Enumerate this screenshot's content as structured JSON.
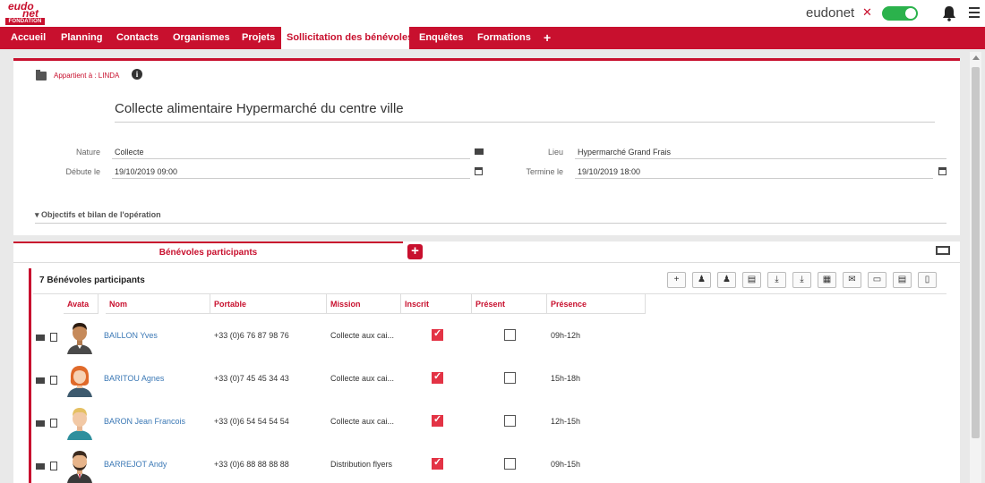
{
  "app": {
    "logo_top": "eudo",
    "logo_mid": "net",
    "logo_sub": "FONDATION",
    "brand": "eudonet",
    "brand_mark": "✕"
  },
  "nav": {
    "items": [
      "Accueil",
      "Planning",
      "Contacts",
      "Organismes",
      "Projets",
      "Sollicitation des bénévoles",
      "Enquêtes",
      "Formations",
      "+"
    ],
    "active_index": 5
  },
  "record": {
    "owner": "Appartient à : LINDA",
    "title": "Collecte alimentaire Hypermarché du centre ville",
    "fields": {
      "nature_label": "Nature",
      "nature_value": "Collecte",
      "debut_label": "Débute le",
      "debut_value": "19/10/2019 09:00",
      "lieu_label": "Lieu",
      "lieu_value": "Hypermarché Grand Frais",
      "termine_label": "Termine le",
      "termine_value": "19/10/2019 18:00"
    },
    "objectifs": "▾  Objectifs et bilan de l'opération"
  },
  "tabs": {
    "active_label": "Bénévoles participants",
    "add_label": "+"
  },
  "participants": {
    "count_label": "7 Bénévoles participants",
    "toolbar_icons": [
      "add-icon",
      "add-user-icon",
      "merge-users-icon",
      "filter-icon",
      "download-icon",
      "export-icon",
      "excel-icon",
      "email-icon",
      "sms-icon",
      "report-icon",
      "document-icon"
    ],
    "columns": [
      "Avata",
      "Nom",
      "Portable",
      "Mission",
      "Inscrit",
      "Présent",
      "Présence"
    ],
    "rows": [
      {
        "nom": "BAILLON Yves",
        "portable": "+33 (0)6 76 87 98 76",
        "mission": "Collecte aux cai...",
        "inscrit": true,
        "present": false,
        "presence": "09h-12h",
        "avatar": "man-dark-hair"
      },
      {
        "nom": "BARITOU Agnes",
        "portable": "+33 (0)7 45 45 34 43",
        "mission": "Collecte aux cai...",
        "inscrit": true,
        "present": false,
        "presence": "15h-18h",
        "avatar": "woman-red-hair"
      },
      {
        "nom": "BARON Jean Francois",
        "portable": "+33 (0)6 54 54 54 54",
        "mission": "Collecte aux cai...",
        "inscrit": true,
        "present": false,
        "presence": "12h-15h",
        "avatar": "man-blond"
      },
      {
        "nom": "BARREJOT Andy",
        "portable": "+33 (0)6 88 88 88 88",
        "mission": "Distribution flyers",
        "inscrit": true,
        "present": false,
        "presence": "09h-15h",
        "avatar": "man-beard"
      }
    ]
  },
  "colors": {
    "brand_red": "#c8102e",
    "toggle_green": "#2bb24c",
    "link_blue": "#3b78b5"
  }
}
